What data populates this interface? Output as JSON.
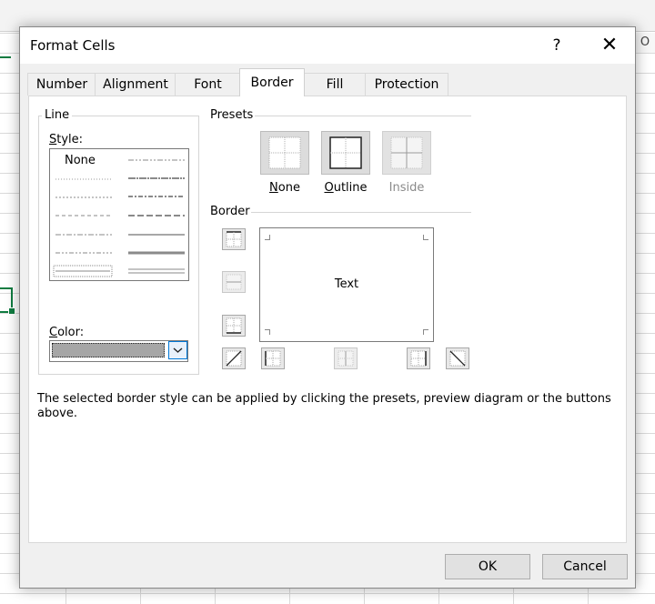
{
  "dialog": {
    "title": "Format Cells",
    "help_glyph": "?",
    "close_glyph": "✕"
  },
  "sheet": {
    "column_header": "O"
  },
  "tabs": [
    {
      "label": "Number"
    },
    {
      "label": "Alignment"
    },
    {
      "label": "Font"
    },
    {
      "label": "Border",
      "active": true
    },
    {
      "label": "Fill"
    },
    {
      "label": "Protection"
    }
  ],
  "line_group": {
    "label": "Line",
    "style_label_first": "S",
    "style_label_rest": "tyle:",
    "none_option": "None",
    "color_label_first": "C",
    "color_label_rest": "olor:",
    "selected_color": "#a6a6a6"
  },
  "presets": {
    "label": "Presets",
    "none_first": "N",
    "none_rest": "one",
    "outline_first": "O",
    "outline_rest": "utline",
    "inside": "Inside"
  },
  "border": {
    "label": "Border",
    "preview_text": "Text"
  },
  "help_text": "The selected border style can be applied by clicking the presets, preview diagram or the buttons above.",
  "buttons": {
    "ok": "OK",
    "cancel": "Cancel"
  }
}
